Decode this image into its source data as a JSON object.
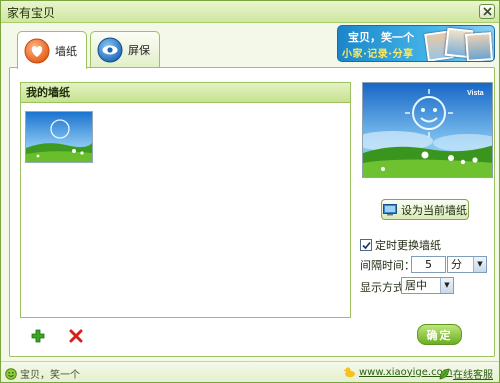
{
  "window": {
    "title": "家有宝贝"
  },
  "banner": {
    "line1": "宝贝，笑一个",
    "line2": "小家·记录·分享"
  },
  "tabs": [
    {
      "label": "墙纸",
      "icon": "heart-icon"
    },
    {
      "label": "屏保",
      "icon": "eye-icon"
    }
  ],
  "wallpaper_panel": {
    "header": "我的墙纸"
  },
  "preview": {
    "logo": "Vista"
  },
  "controls": {
    "set_button_label": "设为当前墙纸",
    "auto_change_label": "定时更换墙纸",
    "auto_change_checked": true,
    "interval_label": "间隔时间：",
    "interval_value": "5",
    "interval_unit": "分",
    "display_mode_label": "显示方式：",
    "display_mode_value": "居中"
  },
  "actions": {
    "ok_label": "确定"
  },
  "status": {
    "slogan": "宝贝，笑一个",
    "website": "www.xiaoyige.com",
    "service": "在线客服"
  },
  "colors": {
    "accent_green": "#7aa43c",
    "ok_button": "#6cae22",
    "delete_red": "#d8201a",
    "banner_blue": "#1a86c9"
  }
}
